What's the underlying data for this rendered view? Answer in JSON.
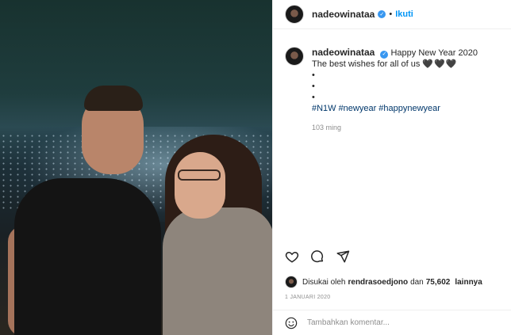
{
  "post": {
    "username": "nadeowinataa",
    "follow_label": "Ikuti",
    "separator": "•"
  },
  "caption": {
    "username": "nadeowinataa",
    "line1": "Happy New Year 2020",
    "line2": "The best wishes for all of us",
    "hearts": "🖤🖤🖤",
    "bullets": [
      "•",
      "•",
      "•"
    ],
    "hashtags": [
      "#N1W",
      "#newyear",
      "#happynewyear"
    ],
    "time_ago": "103 ming"
  },
  "likes": {
    "prefix": "Disukai oleh",
    "user": "rendrasoedjono",
    "connector": "dan",
    "count": "75,602",
    "suffix": "lainnya"
  },
  "date": "1 JANUARI 2020",
  "comment_box": {
    "placeholder": "Tambahkan komentar..."
  },
  "icons": [
    "verified-badge-icon",
    "heart-icon",
    "comment-icon",
    "share-icon",
    "emoji-icon"
  ],
  "colors": {
    "accent": "#0095f6",
    "hashtag": "#00376b",
    "muted": "#8e8e8e"
  }
}
